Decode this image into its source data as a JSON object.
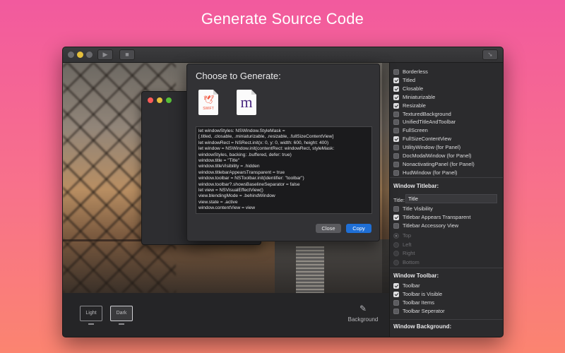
{
  "headline": "Generate Source Code",
  "colors": {
    "background_top": "#f25a9e",
    "background_bottom": "#fb8470",
    "window": "#2b2b2d",
    "accent_blue": "#1f6fd6",
    "traffic_red": "#fc5b57",
    "traffic_yellow": "#e5bf3c",
    "traffic_green": "#57c038"
  },
  "toolbar": {
    "play_icon": "play-icon",
    "stop_icon": "stop-icon",
    "export_icon": "export-arrow-icon"
  },
  "bottom": {
    "light_label": "Light",
    "dark_label": "Dark",
    "background_label": "Background",
    "selected_mode": "Dark"
  },
  "sheet": {
    "title": "Choose to Generate:",
    "swift_label": "SWIFT",
    "objc_label": "m",
    "code_lines": [
      "let windowStyles: NSWindow.StyleMask =",
      "[.titled, .closable, .miniaturizable, .resizable, .fullSizeContentView]",
      "let windowRect = NSRect.init(x: 0, y: 0, width: 600, height: 400)",
      "let window = NSWindow.init(contentRect: windowRect, styleMask:",
      "windowStyles, backing: .buffered, defer: true)",
      "window.title = \"Title\"",
      "window.titleVisibility = .hidden",
      "window.titlebarAppearsTransparent = true",
      "window.toolbar = NSToolbar.init(identifier: \"toolbar\")",
      "window.toolbar?.showsBaselineSeparator = false",
      "let view = NSVisualEffectView()",
      "view.blendingMode = .behindWindow",
      "view.state = .active",
      "window.contentView = view"
    ],
    "close_label": "Close",
    "copy_label": "Copy"
  },
  "style_mask": [
    {
      "label": "Borderless",
      "checked": false
    },
    {
      "label": "Titled",
      "checked": true
    },
    {
      "label": "Closable",
      "checked": true
    },
    {
      "label": "Miniaturizable",
      "checked": true
    },
    {
      "label": "Resizable",
      "checked": true
    },
    {
      "label": "TexturedBackground",
      "checked": false
    },
    {
      "label": "UnifiedTitleAndToolbar",
      "checked": false
    },
    {
      "label": "FullScreen",
      "checked": false
    },
    {
      "label": "FullSizeContentView",
      "checked": true
    },
    {
      "label": "UtilityWindow (for Panel)",
      "checked": false
    },
    {
      "label": "DocModalWindow (for Panel)",
      "checked": false
    },
    {
      "label": "NonactivatingPanel (for Panel)",
      "checked": false
    },
    {
      "label": "HudWindow (for Panel)",
      "checked": false
    }
  ],
  "titlebar_section": {
    "heading": "Window Titlebar:",
    "title_label": "Title:",
    "title_value": "Title",
    "options": [
      {
        "label": "Title Visibility",
        "checked": false
      },
      {
        "label": "Titlebar Appears Transparent",
        "checked": true
      },
      {
        "label": "Titlebar Accessory View",
        "checked": false
      }
    ],
    "positions": [
      {
        "label": "Top",
        "selected": true
      },
      {
        "label": "Left",
        "selected": false
      },
      {
        "label": "Right",
        "selected": false
      },
      {
        "label": "Bottom",
        "selected": false
      }
    ]
  },
  "toolbar_section": {
    "heading": "Window Toolbar:",
    "options": [
      {
        "label": "Toolbar",
        "checked": true
      },
      {
        "label": "Toolbar is Visible",
        "checked": true
      },
      {
        "label": "Toolbar Items",
        "checked": false
      },
      {
        "label": "Toolbar Seperator",
        "checked": false
      }
    ]
  },
  "background_section": {
    "heading": "Window Background:"
  }
}
